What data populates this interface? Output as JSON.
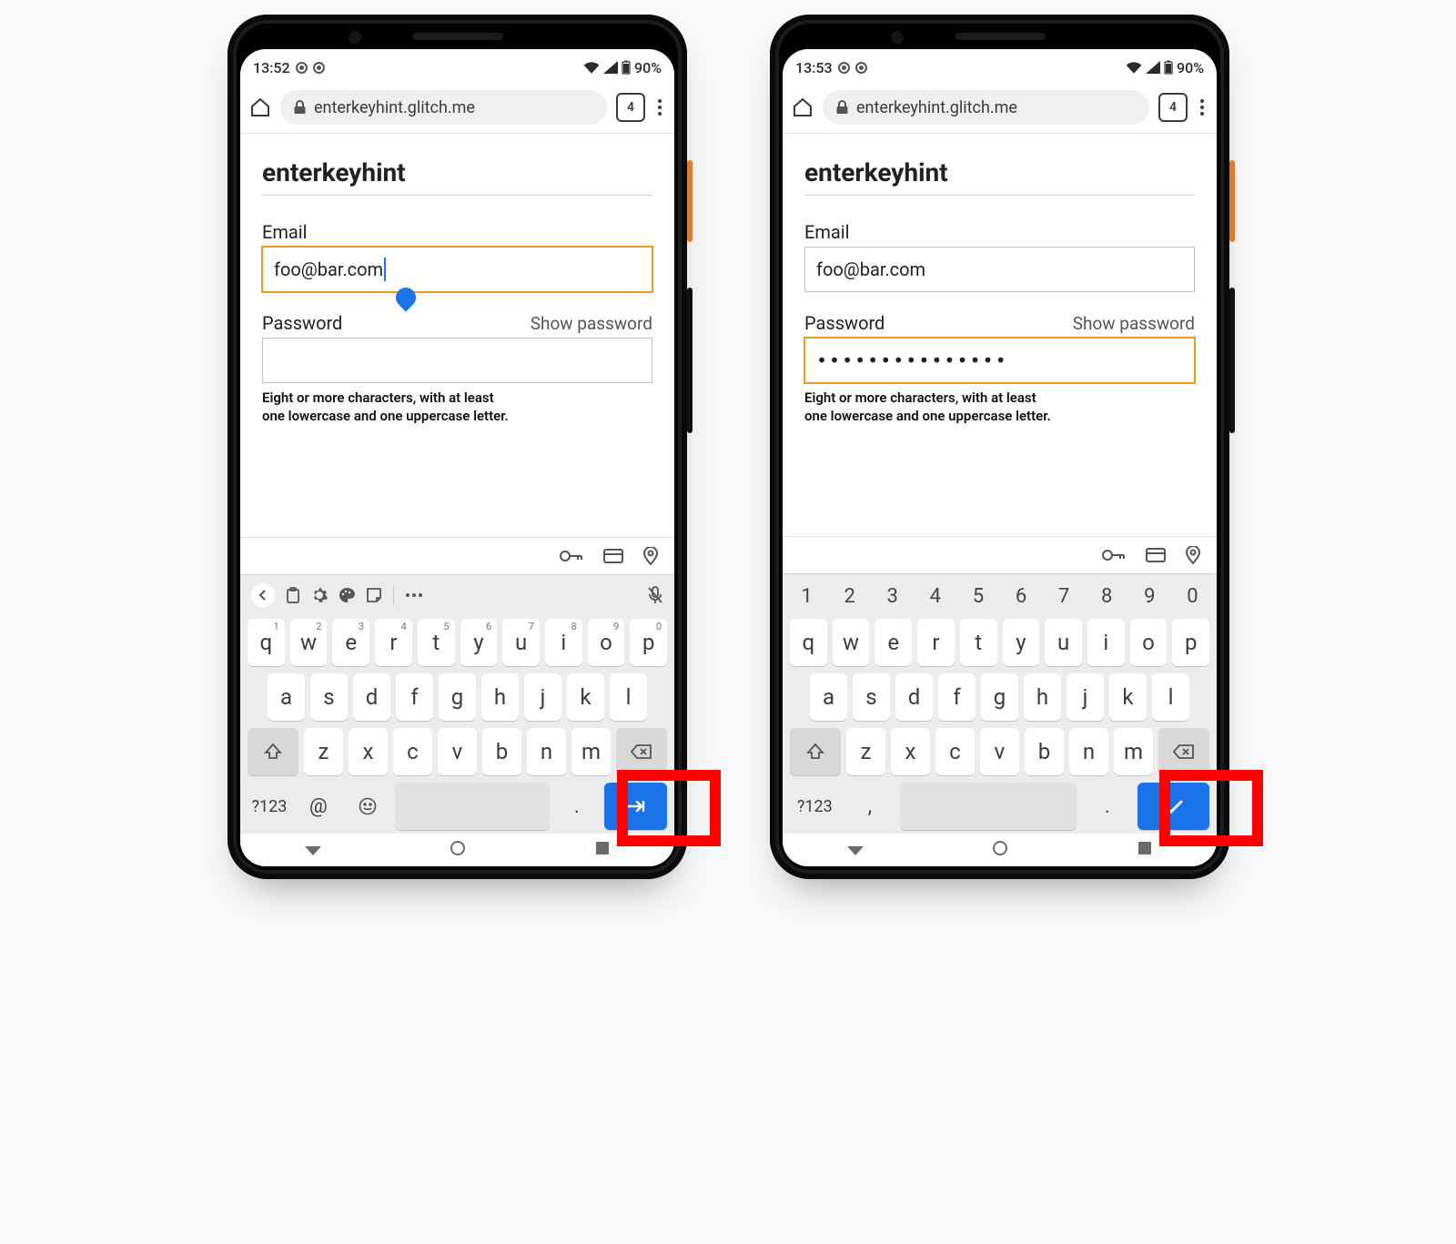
{
  "colors": {
    "accent_blue": "#1a73e8",
    "focus_orange": "#EA9B22",
    "highlight_red": "#ff0000"
  },
  "left": {
    "status": {
      "time": "13:52",
      "battery": "90%"
    },
    "browser": {
      "url": "enterkeyhint.glitch.me",
      "tab_count": "4"
    },
    "page": {
      "title": "enterkeyhint",
      "email_label": "Email",
      "email_value": "foo@bar.com",
      "email_focused": true,
      "password_label": "Password",
      "show_password": "Show password",
      "password_value": "",
      "password_focused": false,
      "hint_line1": "Eight or more characters, with at least",
      "hint_line2": "one lowercase and one uppercase letter."
    },
    "keyboard": {
      "mode": "email",
      "enter_hint": "next",
      "enter_icon": "arrow-right-bar",
      "row1": [
        {
          "k": "q",
          "s": "1"
        },
        {
          "k": "w",
          "s": "2"
        },
        {
          "k": "e",
          "s": "3"
        },
        {
          "k": "r",
          "s": "4"
        },
        {
          "k": "t",
          "s": "5"
        },
        {
          "k": "y",
          "s": "6"
        },
        {
          "k": "u",
          "s": "7"
        },
        {
          "k": "i",
          "s": "8"
        },
        {
          "k": "o",
          "s": "9"
        },
        {
          "k": "p",
          "s": "0"
        }
      ],
      "row2": [
        "a",
        "s",
        "d",
        "f",
        "g",
        "h",
        "j",
        "k",
        "l"
      ],
      "row3": [
        "z",
        "x",
        "c",
        "v",
        "b",
        "n",
        "m"
      ],
      "sym_label": "?123",
      "at_label": "@",
      "period_label": "."
    }
  },
  "right": {
    "status": {
      "time": "13:53",
      "battery": "90%"
    },
    "browser": {
      "url": "enterkeyhint.glitch.me",
      "tab_count": "4"
    },
    "page": {
      "title": "enterkeyhint",
      "email_label": "Email",
      "email_value": "foo@bar.com",
      "email_focused": false,
      "password_label": "Password",
      "show_password": "Show password",
      "password_value": "•••••••••••••••",
      "password_focused": true,
      "hint_line1": "Eight or more characters, with at least",
      "hint_line2": "one lowercase and one uppercase letter."
    },
    "keyboard": {
      "mode": "password",
      "enter_hint": "done",
      "enter_icon": "check",
      "num_row": [
        "1",
        "2",
        "3",
        "4",
        "5",
        "6",
        "7",
        "8",
        "9",
        "0"
      ],
      "row1": [
        {
          "k": "q"
        },
        {
          "k": "w"
        },
        {
          "k": "e"
        },
        {
          "k": "r"
        },
        {
          "k": "t"
        },
        {
          "k": "y"
        },
        {
          "k": "u"
        },
        {
          "k": "i"
        },
        {
          "k": "o"
        },
        {
          "k": "p"
        }
      ],
      "row2": [
        "a",
        "s",
        "d",
        "f",
        "g",
        "h",
        "j",
        "k",
        "l"
      ],
      "row3": [
        "z",
        "x",
        "c",
        "v",
        "b",
        "n",
        "m"
      ],
      "sym_label": "?123",
      "comma_label": ",",
      "period_label": "."
    }
  }
}
